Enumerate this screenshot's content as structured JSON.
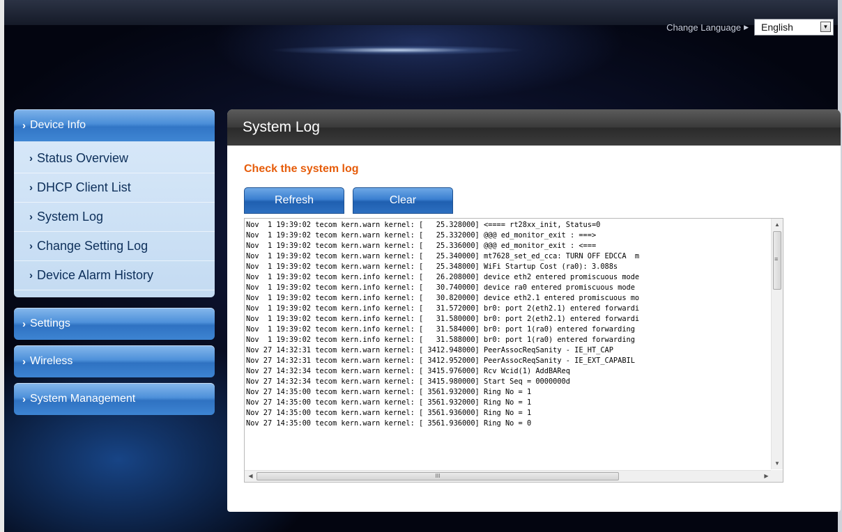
{
  "header": {
    "change_language_label": "Change Language",
    "language_selected": "English"
  },
  "sidebar": {
    "device_info": "Device Info",
    "sub_items": [
      {
        "label": "Status Overview"
      },
      {
        "label": "DHCP Client List"
      },
      {
        "label": "System Log"
      },
      {
        "label": "Change Setting Log"
      },
      {
        "label": "Device Alarm History"
      }
    ],
    "settings": "Settings",
    "wireless": "Wireless",
    "system_management": "System Management"
  },
  "main": {
    "title": "System Log",
    "subtitle": "Check the system log",
    "refresh_label": "Refresh",
    "clear_label": "Clear",
    "log_lines": [
      "Nov  1 19:39:02 tecom kern.warn kernel: [   25.328000] <==== rt28xx_init, Status=0",
      "Nov  1 19:39:02 tecom kern.warn kernel: [   25.332000] @@@ ed_monitor_exit : ===>",
      "Nov  1 19:39:02 tecom kern.warn kernel: [   25.336000] @@@ ed_monitor_exit : <===",
      "Nov  1 19:39:02 tecom kern.warn kernel: [   25.340000] mt7628_set_ed_cca: TURN OFF EDCCA  m",
      "Nov  1 19:39:02 tecom kern.warn kernel: [   25.348000] WiFi Startup Cost (ra0): 3.088s",
      "Nov  1 19:39:02 tecom kern.info kernel: [   26.208000] device eth2 entered promiscuous mode",
      "Nov  1 19:39:02 tecom kern.info kernel: [   30.740000] device ra0 entered promiscuous mode",
      "Nov  1 19:39:02 tecom kern.info kernel: [   30.820000] device eth2.1 entered promiscuous mo",
      "Nov  1 19:39:02 tecom kern.info kernel: [   31.572000] br0: port 2(eth2.1) entered forwardi",
      "Nov  1 19:39:02 tecom kern.info kernel: [   31.580000] br0: port 2(eth2.1) entered forwardi",
      "Nov  1 19:39:02 tecom kern.info kernel: [   31.584000] br0: port 1(ra0) entered forwarding",
      "Nov  1 19:39:02 tecom kern.info kernel: [   31.588000] br0: port 1(ra0) entered forwarding",
      "Nov 27 14:32:31 tecom kern.warn kernel: [ 3412.948000] PeerAssocReqSanity - IE_HT_CAP",
      "Nov 27 14:32:31 tecom kern.warn kernel: [ 3412.952000] PeerAssocReqSanity - IE_EXT_CAPABIL",
      "Nov 27 14:32:34 tecom kern.warn kernel: [ 3415.976000] Rcv Wcid(1) AddBAReq",
      "Nov 27 14:32:34 tecom kern.warn kernel: [ 3415.980000] Start Seq = 0000000d",
      "Nov 27 14:35:00 tecom kern.warn kernel: [ 3561.932000] Ring No = 1",
      "Nov 27 14:35:00 tecom kern.warn kernel: [ 3561.932000] Ring No = 1",
      "Nov 27 14:35:00 tecom kern.warn kernel: [ 3561.936000] Ring No = 1",
      "Nov 27 14:35:00 tecom kern.warn kernel: [ 3561.936000] Ring No = 0"
    ]
  },
  "icons": {
    "scroll_up": "▲",
    "scroll_down": "▼",
    "scroll_left": "◀",
    "scroll_right": "▶",
    "thumb_grip_v": "≡",
    "thumb_grip_h": "III",
    "dropdown": "▼",
    "arrow": "›",
    "triangle_right": "▶"
  }
}
